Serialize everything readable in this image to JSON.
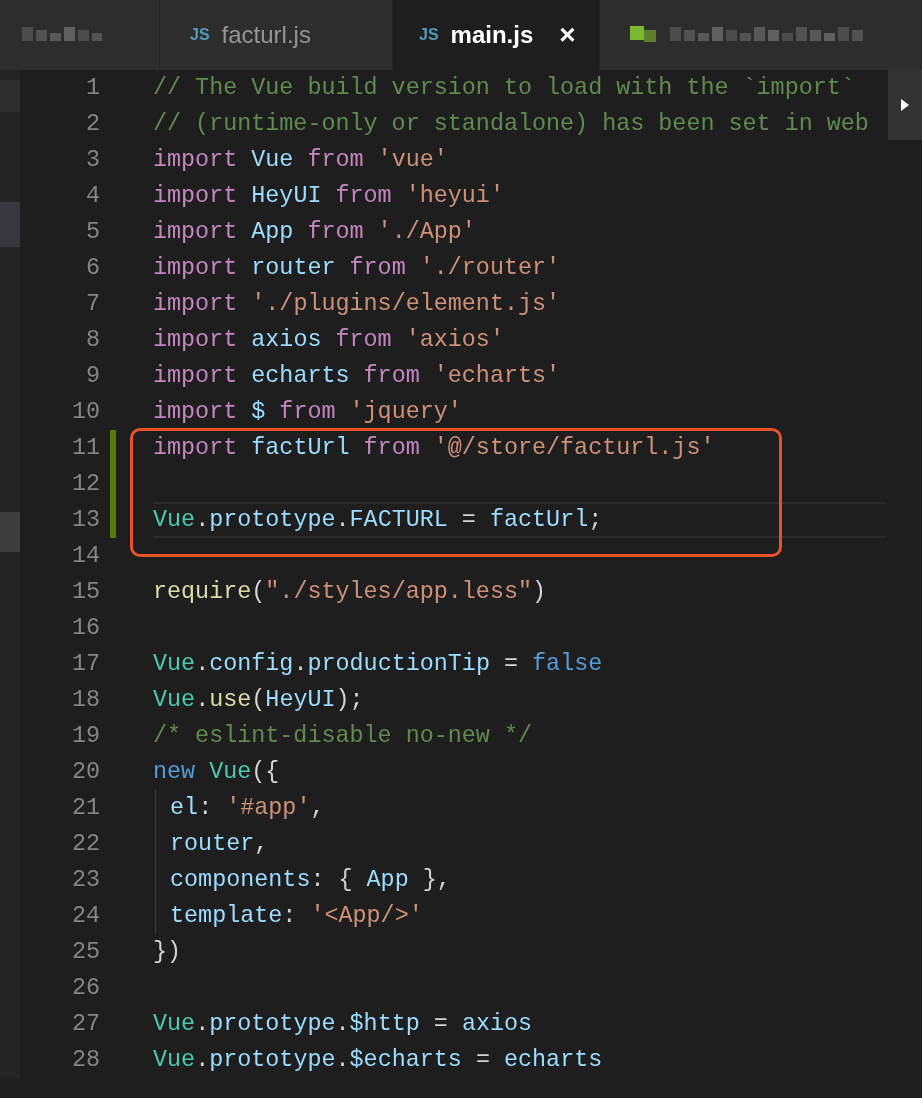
{
  "tabs": [
    {
      "kind": "obscured",
      "selected": false
    },
    {
      "kind": "file",
      "icon": "JS",
      "label": "facturl.js",
      "selected": false
    },
    {
      "kind": "file",
      "icon": "JS",
      "label": "main.js",
      "close": "×",
      "selected": true
    },
    {
      "kind": "obscured_with_icon",
      "selected": false
    }
  ],
  "lines": [
    {
      "number": "1",
      "tokens": [
        {
          "kind": "comment",
          "text": "// The Vue build version to load with the `import`"
        }
      ]
    },
    {
      "number": "2",
      "tokens": [
        {
          "kind": "comment",
          "text": "// (runtime-only or standalone) has been set in web"
        }
      ]
    },
    {
      "number": "3",
      "tokens": [
        {
          "kind": "keyword",
          "text": "import "
        },
        {
          "kind": "variable",
          "text": "Vue "
        },
        {
          "kind": "keyword",
          "text": "from "
        },
        {
          "kind": "string",
          "text": "'vue'"
        }
      ]
    },
    {
      "number": "4",
      "tokens": [
        {
          "kind": "keyword",
          "text": "import "
        },
        {
          "kind": "variable",
          "text": "HeyUI "
        },
        {
          "kind": "keyword",
          "text": "from "
        },
        {
          "kind": "string",
          "text": "'heyui'"
        }
      ]
    },
    {
      "number": "5",
      "tokens": [
        {
          "kind": "keyword",
          "text": "import "
        },
        {
          "kind": "variable",
          "text": "App "
        },
        {
          "kind": "keyword",
          "text": "from "
        },
        {
          "kind": "string",
          "text": "'./App'"
        }
      ]
    },
    {
      "number": "6",
      "tokens": [
        {
          "kind": "keyword",
          "text": "import "
        },
        {
          "kind": "variable",
          "text": "router "
        },
        {
          "kind": "keyword",
          "text": "from "
        },
        {
          "kind": "string",
          "text": "'./router'"
        }
      ]
    },
    {
      "number": "7",
      "tokens": [
        {
          "kind": "keyword",
          "text": "import "
        },
        {
          "kind": "string",
          "text": "'./plugins/element.js'"
        }
      ]
    },
    {
      "number": "8",
      "tokens": [
        {
          "kind": "keyword",
          "text": "import "
        },
        {
          "kind": "variable",
          "text": "axios "
        },
        {
          "kind": "keyword",
          "text": "from "
        },
        {
          "kind": "string",
          "text": "'axios'"
        }
      ]
    },
    {
      "number": "9",
      "tokens": [
        {
          "kind": "keyword",
          "text": "import "
        },
        {
          "kind": "variable",
          "text": "echarts "
        },
        {
          "kind": "keyword",
          "text": "from "
        },
        {
          "kind": "string",
          "text": "'echarts'"
        }
      ]
    },
    {
      "number": "10",
      "tokens": [
        {
          "kind": "keyword",
          "text": "import "
        },
        {
          "kind": "variable",
          "text": "$ "
        },
        {
          "kind": "keyword",
          "text": "from "
        },
        {
          "kind": "string",
          "text": "'jquery'"
        }
      ]
    },
    {
      "number": "11",
      "modified": true,
      "boxed": true,
      "tokens": [
        {
          "kind": "keyword",
          "text": "import "
        },
        {
          "kind": "variable",
          "text": "factUrl "
        },
        {
          "kind": "keyword",
          "text": "from "
        },
        {
          "kind": "string",
          "text": "'@/store/facturl.js'"
        }
      ]
    },
    {
      "number": "12",
      "modified": true,
      "boxed": true
    },
    {
      "number": "13",
      "modified": true,
      "boxed": true,
      "current": true,
      "tokens": [
        {
          "kind": "class",
          "text": "Vue"
        },
        {
          "kind": "plain",
          "text": "."
        },
        {
          "kind": "variable",
          "text": "prototype"
        },
        {
          "kind": "plain",
          "text": "."
        },
        {
          "kind": "variable",
          "text": "FACTURL"
        },
        {
          "kind": "plain",
          "text": " = "
        },
        {
          "kind": "variable",
          "text": "factUrl"
        },
        {
          "kind": "plain",
          "text": ";"
        }
      ]
    },
    {
      "number": "14"
    },
    {
      "number": "15",
      "tokens": [
        {
          "kind": "function",
          "text": "require"
        },
        {
          "kind": "plain",
          "text": "("
        },
        {
          "kind": "string",
          "text": "\"./styles/app.less\""
        },
        {
          "kind": "plain",
          "text": ")"
        }
      ]
    },
    {
      "number": "16"
    },
    {
      "number": "17",
      "tokens": [
        {
          "kind": "class",
          "text": "Vue"
        },
        {
          "kind": "plain",
          "text": "."
        },
        {
          "kind": "variable",
          "text": "config"
        },
        {
          "kind": "plain",
          "text": "."
        },
        {
          "kind": "variable",
          "text": "productionTip"
        },
        {
          "kind": "plain",
          "text": " = "
        },
        {
          "kind": "boolean",
          "text": "false"
        }
      ]
    },
    {
      "number": "18",
      "tokens": [
        {
          "kind": "class",
          "text": "Vue"
        },
        {
          "kind": "plain",
          "text": "."
        },
        {
          "kind": "function",
          "text": "use"
        },
        {
          "kind": "plain",
          "text": "("
        },
        {
          "kind": "variable",
          "text": "HeyUI"
        },
        {
          "kind": "plain",
          "text": ");"
        }
      ]
    },
    {
      "number": "19",
      "tokens": [
        {
          "kind": "comment",
          "text": "/* eslint-disable no-new */"
        }
      ]
    },
    {
      "number": "20",
      "tokens": [
        {
          "kind": "boolean",
          "text": "new "
        },
        {
          "kind": "class",
          "text": "Vue"
        },
        {
          "kind": "plain",
          "text": "({"
        }
      ]
    },
    {
      "number": "21",
      "indent": true,
      "tokens": [
        {
          "kind": "variable",
          "text": "el"
        },
        {
          "kind": "plain",
          "text": ": "
        },
        {
          "kind": "string",
          "text": "'#app'"
        },
        {
          "kind": "plain",
          "text": ","
        }
      ]
    },
    {
      "number": "22",
      "indent": true,
      "tokens": [
        {
          "kind": "variable",
          "text": "router"
        },
        {
          "kind": "plain",
          "text": ","
        }
      ]
    },
    {
      "number": "23",
      "indent": true,
      "tokens": [
        {
          "kind": "variable",
          "text": "components"
        },
        {
          "kind": "plain",
          "text": ": { "
        },
        {
          "kind": "variable",
          "text": "App"
        },
        {
          "kind": "plain",
          "text": " },"
        }
      ]
    },
    {
      "number": "24",
      "indent": true,
      "tokens": [
        {
          "kind": "variable",
          "text": "template"
        },
        {
          "kind": "plain",
          "text": ": "
        },
        {
          "kind": "string",
          "text": "'<App/>'"
        }
      ]
    },
    {
      "number": "25",
      "tokens": [
        {
          "kind": "plain",
          "text": "})"
        }
      ]
    },
    {
      "number": "26"
    },
    {
      "number": "27",
      "tokens": [
        {
          "kind": "class",
          "text": "Vue"
        },
        {
          "kind": "plain",
          "text": "."
        },
        {
          "kind": "variable",
          "text": "prototype"
        },
        {
          "kind": "plain",
          "text": "."
        },
        {
          "kind": "variable",
          "text": "$http"
        },
        {
          "kind": "plain",
          "text": " = "
        },
        {
          "kind": "variable",
          "text": "axios"
        }
      ]
    },
    {
      "number": "28",
      "tokens": [
        {
          "kind": "class",
          "text": "Vue"
        },
        {
          "kind": "plain",
          "text": "."
        },
        {
          "kind": "variable",
          "text": "prototype"
        },
        {
          "kind": "plain",
          "text": "."
        },
        {
          "kind": "variable",
          "text": "$echarts"
        },
        {
          "kind": "plain",
          "text": " = "
        },
        {
          "kind": "variable",
          "text": "echarts"
        }
      ]
    }
  ]
}
